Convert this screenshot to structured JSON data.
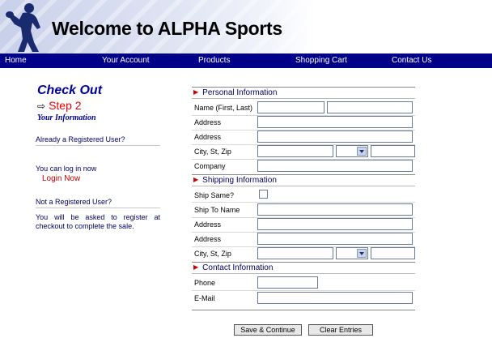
{
  "banner": {
    "title": "Welcome to ALPHA Sports"
  },
  "nav": {
    "items": [
      "Home",
      "Your Account",
      "Products",
      "Shopping Cart",
      "Contact Us"
    ]
  },
  "sidebar": {
    "checkout_title": "Check Out",
    "step_label": "Step 2",
    "subtitle": "Your Information",
    "registered_question": "Already a Registered User?",
    "login_prompt": "You can log in now",
    "login_link": "Login Now",
    "not_registered_question": "Not a Registered User?",
    "register_note": "You will be asked to register at checkout to complete the sale."
  },
  "form": {
    "personal": {
      "heading": "Personal Information",
      "name_label": "Name (First, Last)",
      "address1_label": "Address",
      "address2_label": "Address",
      "city_label": "City, St, Zip",
      "company_label": "Company"
    },
    "shipping": {
      "heading": "Shipping Information",
      "ship_same_label": "Ship Same?",
      "ship_same_checked": false,
      "ship_to_label": "Ship To Name",
      "address1_label": "Address",
      "address2_label": "Address",
      "city_label": "City, St, Zip"
    },
    "contact": {
      "heading": "Contact Information",
      "phone_label": "Phone",
      "email_label": "E-Mail"
    }
  },
  "buttons": {
    "save_label": "Save & Continue",
    "clear_label": "Clear Entries"
  },
  "colors": {
    "nav_bg": "#000088",
    "accent_red": "#cc0000",
    "heading_blue": "#000099"
  }
}
